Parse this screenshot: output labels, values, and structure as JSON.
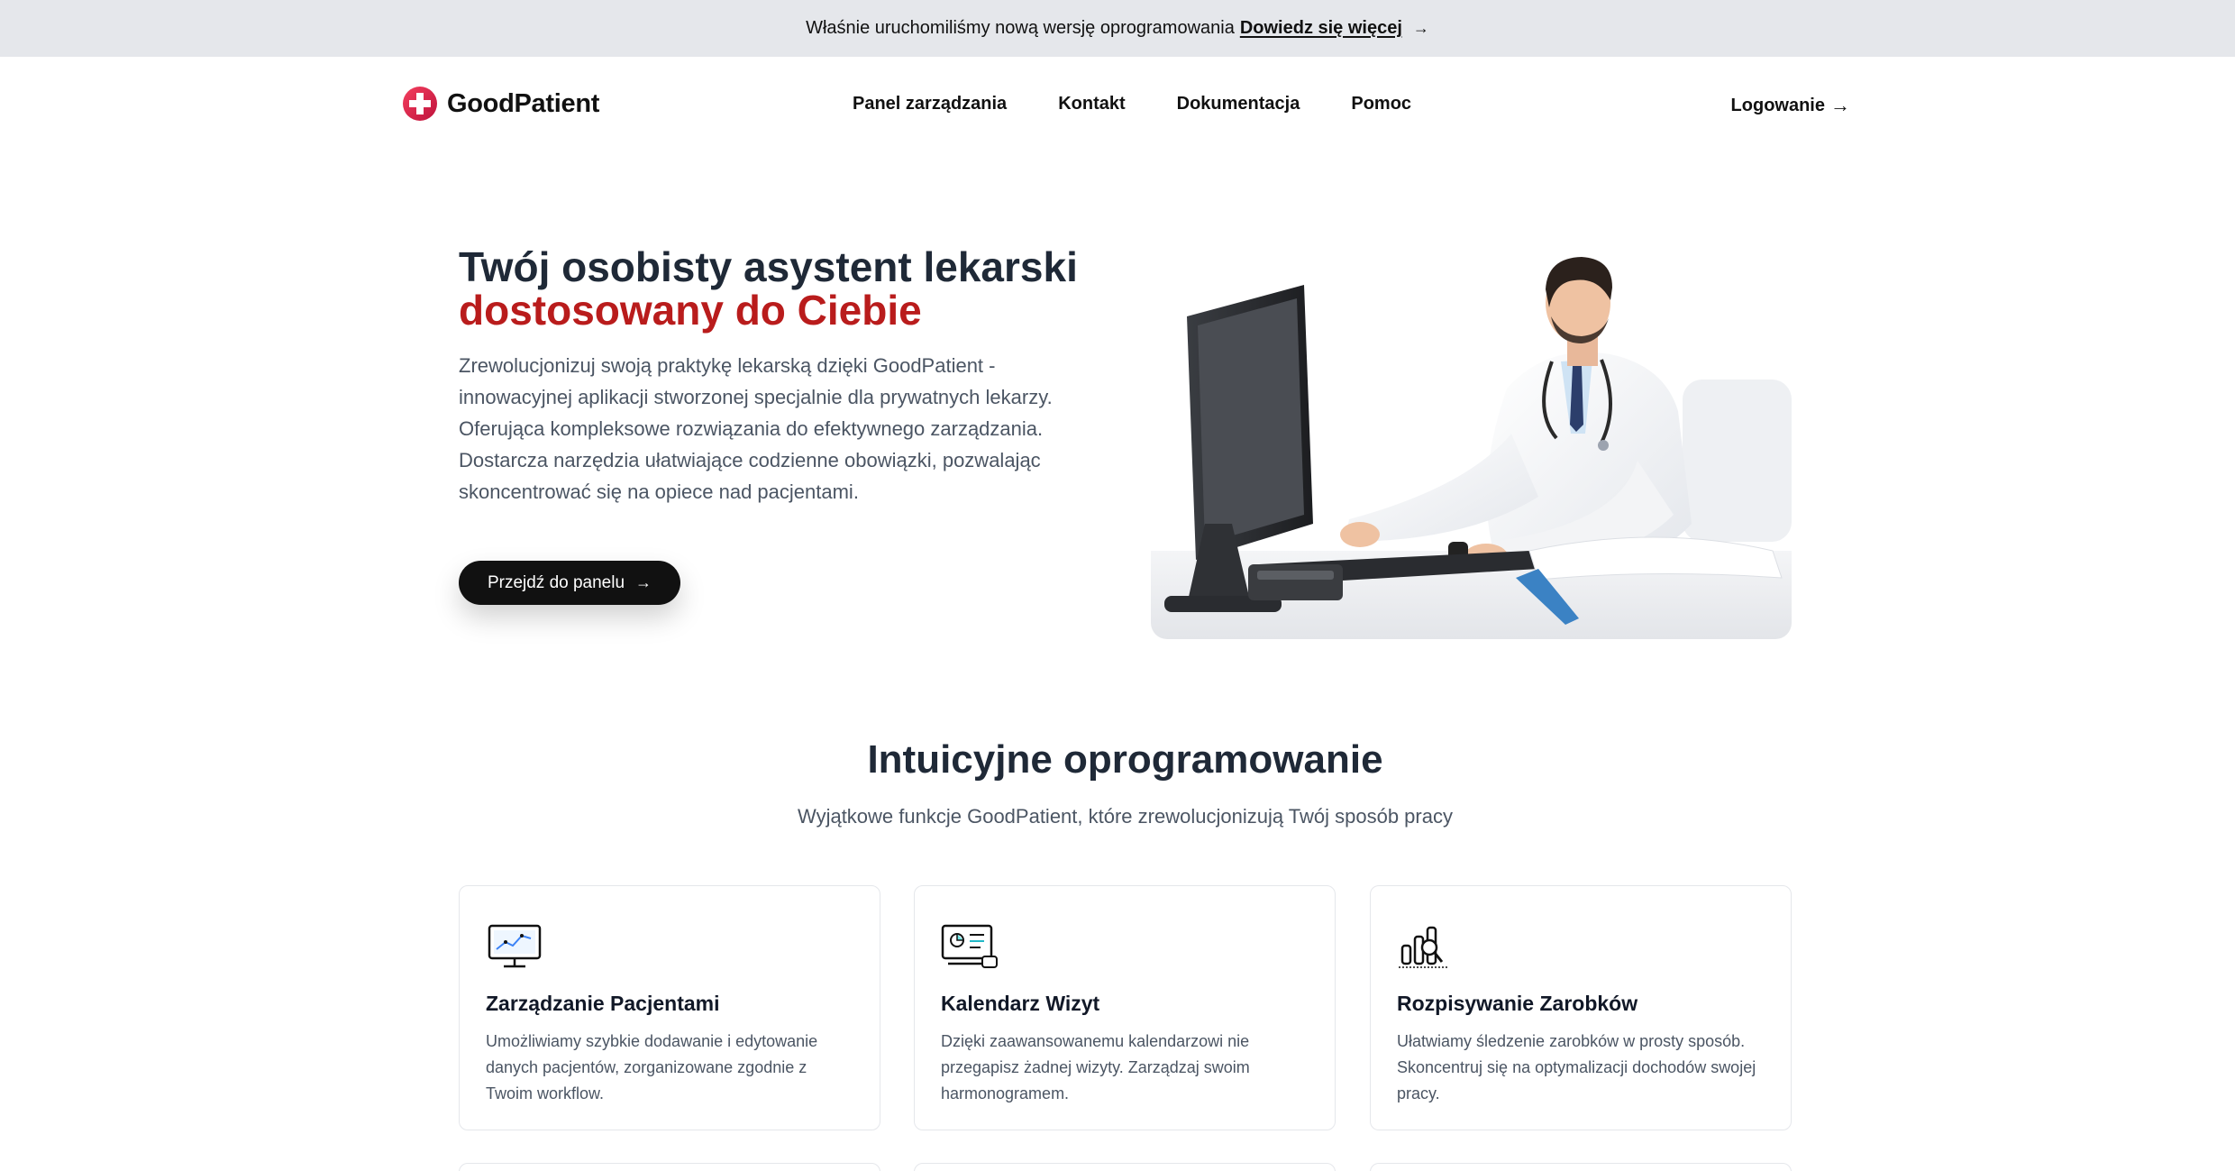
{
  "announcement": {
    "text": "Właśnie uruchomiliśmy nową wersję oprogramowania",
    "link_label": "Dowiedz się więcej",
    "arrow": "→"
  },
  "header": {
    "brand": "GoodPatient",
    "logo_icon": "medical-cross-icon",
    "nav": [
      "Panel zarządzania",
      "Kontakt",
      "Dokumentacja",
      "Pomoc"
    ],
    "login_label": "Logowanie",
    "login_arrow": "→"
  },
  "hero": {
    "title_line1": "Twój osobisty asystent lekarski",
    "title_line2": "dostosowany do Ciebie",
    "description": "Zrewolucjonizuj swoją praktykę lekarską dzięki GoodPatient - innowacyjnej aplikacji stworzonej specjalnie dla prywatnych lekarzy. Oferująca kompleksowe rozwiązania do efektywnego zarządzania. Dostarcza narzędzia ułatwiające codzienne obowiązki, pozwalając skoncentrować się na opiece nad pacjentami.",
    "cta_label": "Przejdź do panelu",
    "cta_arrow": "→",
    "image": "doctor-at-computer-photo"
  },
  "features": {
    "title": "Intuicyjne oprogramowanie",
    "subtitle": "Wyjątkowe funkcje GoodPatient, które zrewolucjonizują Twój sposób pracy",
    "cards": [
      {
        "icon": "monitor-chart-icon",
        "title": "Zarządzanie Pacjentami",
        "text": "Umożliwiamy szybkie dodawanie i edytowanie danych pacjentów, zorganizowane zgodnie z Twoim workflow."
      },
      {
        "icon": "calendar-dashboard-icon",
        "title": "Kalendarz Wizyt",
        "text": "Dzięki zaawansowanemu kalendarzowi nie przegapisz żadnej wizyty. Zarządzaj swoim harmonogramem."
      },
      {
        "icon": "bar-chart-search-icon",
        "title": "Rozpisywanie Zarobków",
        "text": "Ułatwiamy śledzenie zarobków w prosty sposób. Skoncentruj się na optymalizacji dochodów swojej pracy."
      }
    ]
  },
  "colors": {
    "accent_red": "#b91c1c",
    "logo_red": "#e11d48",
    "dark": "#111111",
    "announce_bg": "#e5e7eb"
  }
}
